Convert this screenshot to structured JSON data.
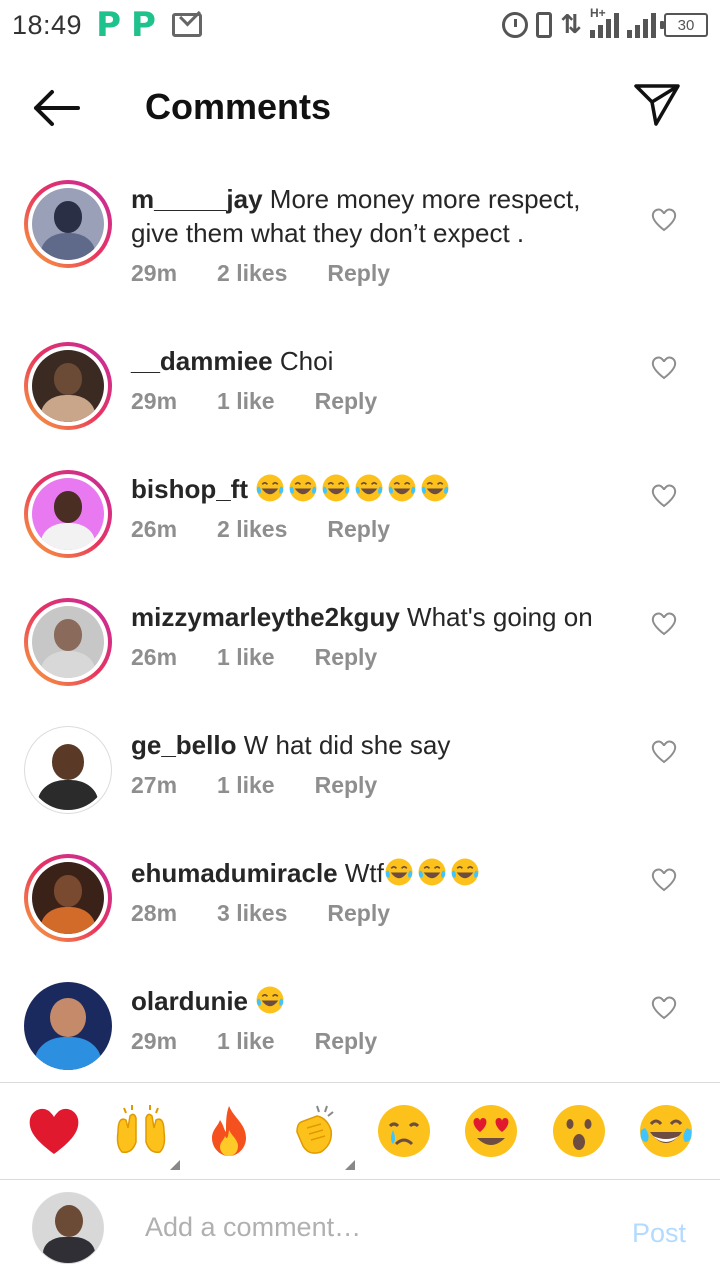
{
  "status": {
    "time": "18:49",
    "p_glyph": "P",
    "battery": "30"
  },
  "header": {
    "title": "Comments"
  },
  "comments": [
    {
      "username": "m_____jay",
      "text": "More money more respect, give them what they don’t expect .",
      "time": "29m",
      "likes": "2 likes",
      "reply": "Reply",
      "laughs": 0
    },
    {
      "username": "__dammiee",
      "text": "Choi",
      "time": "29m",
      "likes": "1 like",
      "reply": "Reply",
      "laughs": 0
    },
    {
      "username": "bishop_ft",
      "text": "",
      "time": "26m",
      "likes": "2 likes",
      "reply": "Reply",
      "laughs": 6
    },
    {
      "username": "mizzymarleythe2kguy",
      "text": "What's going on",
      "time": "26m",
      "likes": "1 like",
      "reply": "Reply",
      "laughs": 0
    },
    {
      "username": "ge_bello",
      "text": "W hat did she say",
      "time": "27m",
      "likes": "1 like",
      "reply": "Reply",
      "laughs": 0
    },
    {
      "username": "ehumadumiracle",
      "text": "Wtf",
      "time": "28m",
      "likes": "3 likes",
      "reply": "Reply",
      "laughs": 3
    },
    {
      "username": "olardunie",
      "text": "",
      "time": "29m",
      "likes": "1 like",
      "reply": "Reply",
      "laughs": 1
    }
  ],
  "emoji_bar": [
    "red-heart",
    "raising-hands",
    "fire",
    "clapping-hands",
    "crying-face",
    "heart-eyes-face",
    "astonished-face",
    "tears-of-joy-face"
  ],
  "composer": {
    "placeholder": "Add a comment…",
    "post_label": "Post"
  },
  "colors": {
    "ring_start": "#f9a83a",
    "ring_end": "#c32aa3",
    "post_disabled": "#b3dbff",
    "meta_gray": "#8e8e8e",
    "status_green": "#1fc28d"
  }
}
